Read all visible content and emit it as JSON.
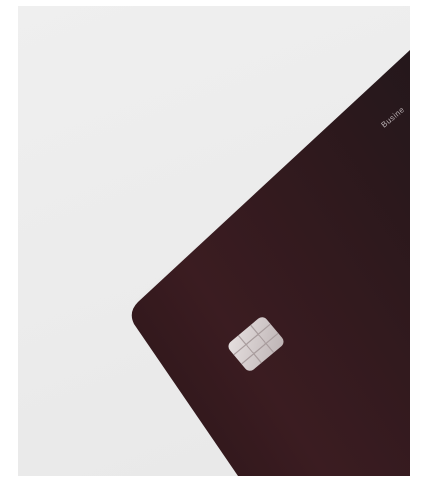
{
  "card": {
    "brand_text": "Busine",
    "colors": {
      "background": "#ececec",
      "card_dark": "#2a1619",
      "card_mid": "#3a1c21",
      "chip": "#cfc7c7"
    }
  },
  "icons": [
    "chip-icon"
  ]
}
